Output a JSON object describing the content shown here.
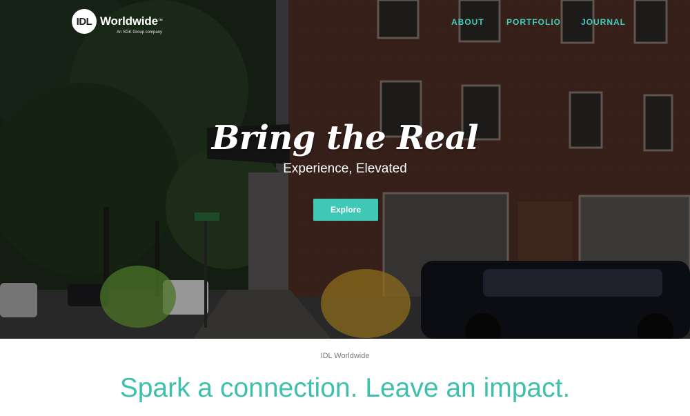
{
  "brand": {
    "badge": "IDL",
    "name": "Worldwide",
    "trademark": "™",
    "tagline": "An SGK Group company"
  },
  "nav": {
    "items": [
      "ABOUT",
      "PORTFOLIO",
      "JOURNAL"
    ]
  },
  "hero": {
    "title": "Bring the Real",
    "subtitle": "Experience, Elevated",
    "cta": "Explore",
    "photo_description": "street-corner-brick-building-cyclists"
  },
  "section": {
    "label": "IDL Worldwide",
    "headline": "Spark a connection. Leave an impact."
  },
  "colors": {
    "accent": "#3fc8b5",
    "nav_link": "#3fd0bf",
    "headline": "#3fc0ad",
    "label": "#7a7a7a"
  }
}
